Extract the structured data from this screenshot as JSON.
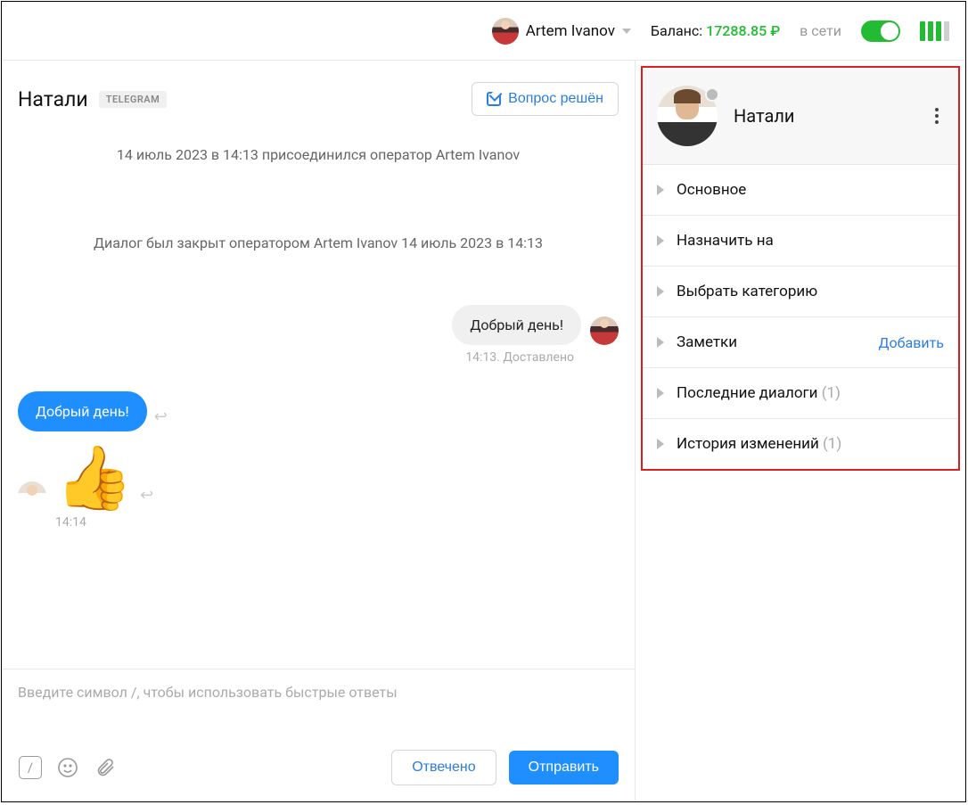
{
  "header": {
    "user_name": "Artem Ivanov",
    "balance_label": "Баланс:",
    "balance_value": "17288.85 ₽",
    "online_label": "в сети"
  },
  "chat": {
    "title": "Натали",
    "channel_badge": "TELEGRAM",
    "resolved_button": "Вопрос решён",
    "system_msg_join": "14 июль 2023 в 14:13 присоединился оператор Artem Ivanov",
    "system_msg_close": "Диалог был закрыт оператором Artem Ivanov 14 июль 2023 в 14:13",
    "msg_out_1": "Добрый день!",
    "msg_out_1_meta": "14:13. Доставлено",
    "msg_in_1": "Добрый день!",
    "msg_in_2_emoji": "👍",
    "msg_in_meta": "14:14",
    "input_placeholder": "Введите символ /, чтобы использовать быстрые ответы",
    "answered_button": "Отвечено",
    "send_button": "Отправить"
  },
  "side": {
    "contact_name": "Натали",
    "sections": {
      "main": "Основное",
      "assign": "Назначить на",
      "category": "Выбрать категорию",
      "notes": "Заметки",
      "notes_action": "Добавить",
      "recent": "Последние диалоги",
      "recent_count": "(1)",
      "history": "История изменений",
      "history_count": "(1)"
    }
  }
}
